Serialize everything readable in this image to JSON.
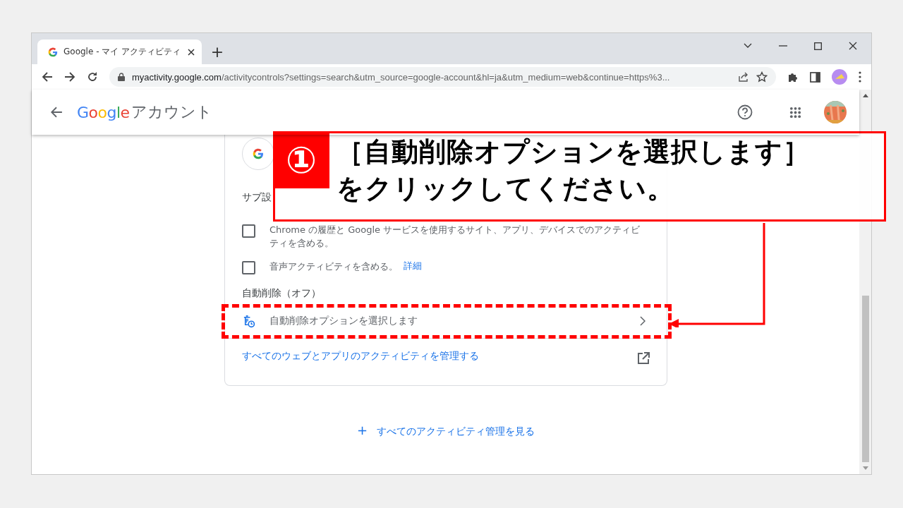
{
  "browser": {
    "tab": {
      "title": "Google - マイ アクティビティ",
      "selected": true
    },
    "new_tab": "+",
    "url_host": "myactivity.google.com",
    "url_path": "/activitycontrols?settings=search&utm_source=google-account&hl=ja&utm_medium=web&continue=https%3..."
  },
  "header": {
    "logo": "Google",
    "title": "アカウント"
  },
  "card": {
    "section_label": "サブ設",
    "options": [
      {
        "label": "Chrome の履歴と Google サービスを使用するサイト、アプリ、デバイスでのアクティビティを含める。",
        "checked": false
      },
      {
        "label": "音声アクティビティを含める。",
        "link": "詳細",
        "checked": false
      }
    ],
    "auto_delete_label": "自動削除（オフ）",
    "auto_delete_option": "自動削除オプションを選択します",
    "manage_link": "すべてのウェブとアプリのアクティビティを管理する"
  },
  "footer_link": {
    "icon": "+",
    "label": "すべてのアクティビティ管理を見る"
  },
  "callout": {
    "number": "①",
    "lines": [
      "［自動削除オプションを選択します］",
      "をクリックしてください。"
    ]
  }
}
